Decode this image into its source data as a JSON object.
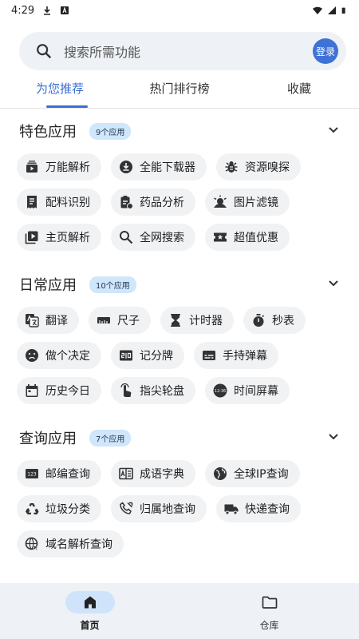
{
  "status_bar": {
    "time": "4:29"
  },
  "search": {
    "placeholder": "搜索所需功能",
    "login_label": "登录"
  },
  "tabs": [
    {
      "label": "为您推荐",
      "active": true
    },
    {
      "label": "热门排行榜",
      "active": false
    },
    {
      "label": "收藏",
      "active": false
    }
  ],
  "sections": [
    {
      "title": "特色应用",
      "badge": "9个应用",
      "items": [
        {
          "label": "万能解析",
          "icon": "video-stack-icon"
        },
        {
          "label": "全能下载器",
          "icon": "download-circle-icon"
        },
        {
          "label": "资源嗅探",
          "icon": "bug-icon"
        },
        {
          "label": "配料识别",
          "icon": "receipt-icon"
        },
        {
          "label": "药品分析",
          "icon": "medicine-clipboard-icon"
        },
        {
          "label": "图片滤镜",
          "icon": "image-filter-icon"
        },
        {
          "label": "主页解析",
          "icon": "playlist-play-icon"
        },
        {
          "label": "全网搜索",
          "icon": "search-icon"
        },
        {
          "label": "超值优惠",
          "icon": "coupon-icon"
        }
      ]
    },
    {
      "title": "日常应用",
      "badge": "10个应用",
      "items": [
        {
          "label": "翻译",
          "icon": "translate-icon"
        },
        {
          "label": "尺子",
          "icon": "ruler-icon"
        },
        {
          "label": "计时器",
          "icon": "hourglass-icon"
        },
        {
          "label": "秒表",
          "icon": "stopwatch-icon"
        },
        {
          "label": "做个决定",
          "icon": "mood-face-icon"
        },
        {
          "label": "记分牌",
          "icon": "scoreboard-icon"
        },
        {
          "label": "手持弹幕",
          "icon": "subtitles-icon"
        },
        {
          "label": "历史今日",
          "icon": "calendar-icon"
        },
        {
          "label": "指尖轮盘",
          "icon": "touch-finger-icon"
        },
        {
          "label": "时间屏幕",
          "icon": "clock-screen-icon"
        }
      ]
    },
    {
      "title": "查询应用",
      "badge": "7个应用",
      "items": [
        {
          "label": "邮编查询",
          "icon": "numbers-123-icon"
        },
        {
          "label": "成语字典",
          "icon": "dictionary-icon"
        },
        {
          "label": "全球IP查询",
          "icon": "globe-icon"
        },
        {
          "label": "垃圾分类",
          "icon": "recycle-icon"
        },
        {
          "label": "归属地查询",
          "icon": "phone-call-icon"
        },
        {
          "label": "快递查询",
          "icon": "truck-icon"
        },
        {
          "label": "域名解析查询",
          "icon": "globe-cursor-icon"
        }
      ]
    }
  ],
  "bottom_nav": [
    {
      "label": "首页",
      "icon": "home-icon",
      "active": true
    },
    {
      "label": "仓库",
      "icon": "folder-icon",
      "active": false
    }
  ],
  "colors": {
    "accent": "#3b6fd6",
    "login_bg": "#3f72d6",
    "badge_bg": "#cfe6fb",
    "chip_bg": "#f1f2f4"
  }
}
